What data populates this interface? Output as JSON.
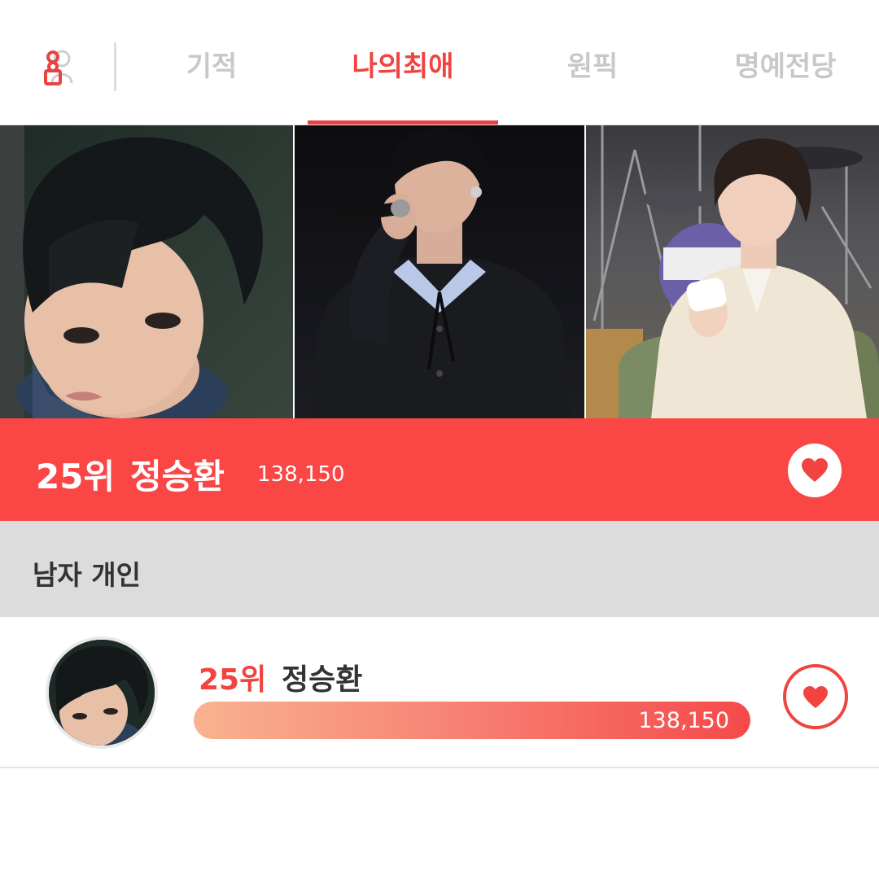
{
  "nav": {
    "tabs": [
      {
        "label": "기적",
        "active": false
      },
      {
        "label": "나의최애",
        "active": true
      },
      {
        "label": "원픽",
        "active": false
      },
      {
        "label": "명예전당",
        "active": false
      }
    ],
    "profile_icon": "user-icon",
    "accent_color": "#f1433f"
  },
  "photos": [
    {
      "name": "idol-closeup-photo"
    },
    {
      "name": "idol-singing-photo"
    },
    {
      "name": "idol-interview-photo"
    }
  ],
  "banner": {
    "rank": "25위",
    "name": "정승환",
    "score": "138,150",
    "heart_icon": "heart-icon",
    "background_color": "#fa4645"
  },
  "category": {
    "label": "남자 개인"
  },
  "ranking": {
    "items": [
      {
        "rank": "25위",
        "name": "정승환",
        "score": "138,150",
        "progress_percent": 100,
        "heart_icon": "heart-icon"
      }
    ]
  }
}
